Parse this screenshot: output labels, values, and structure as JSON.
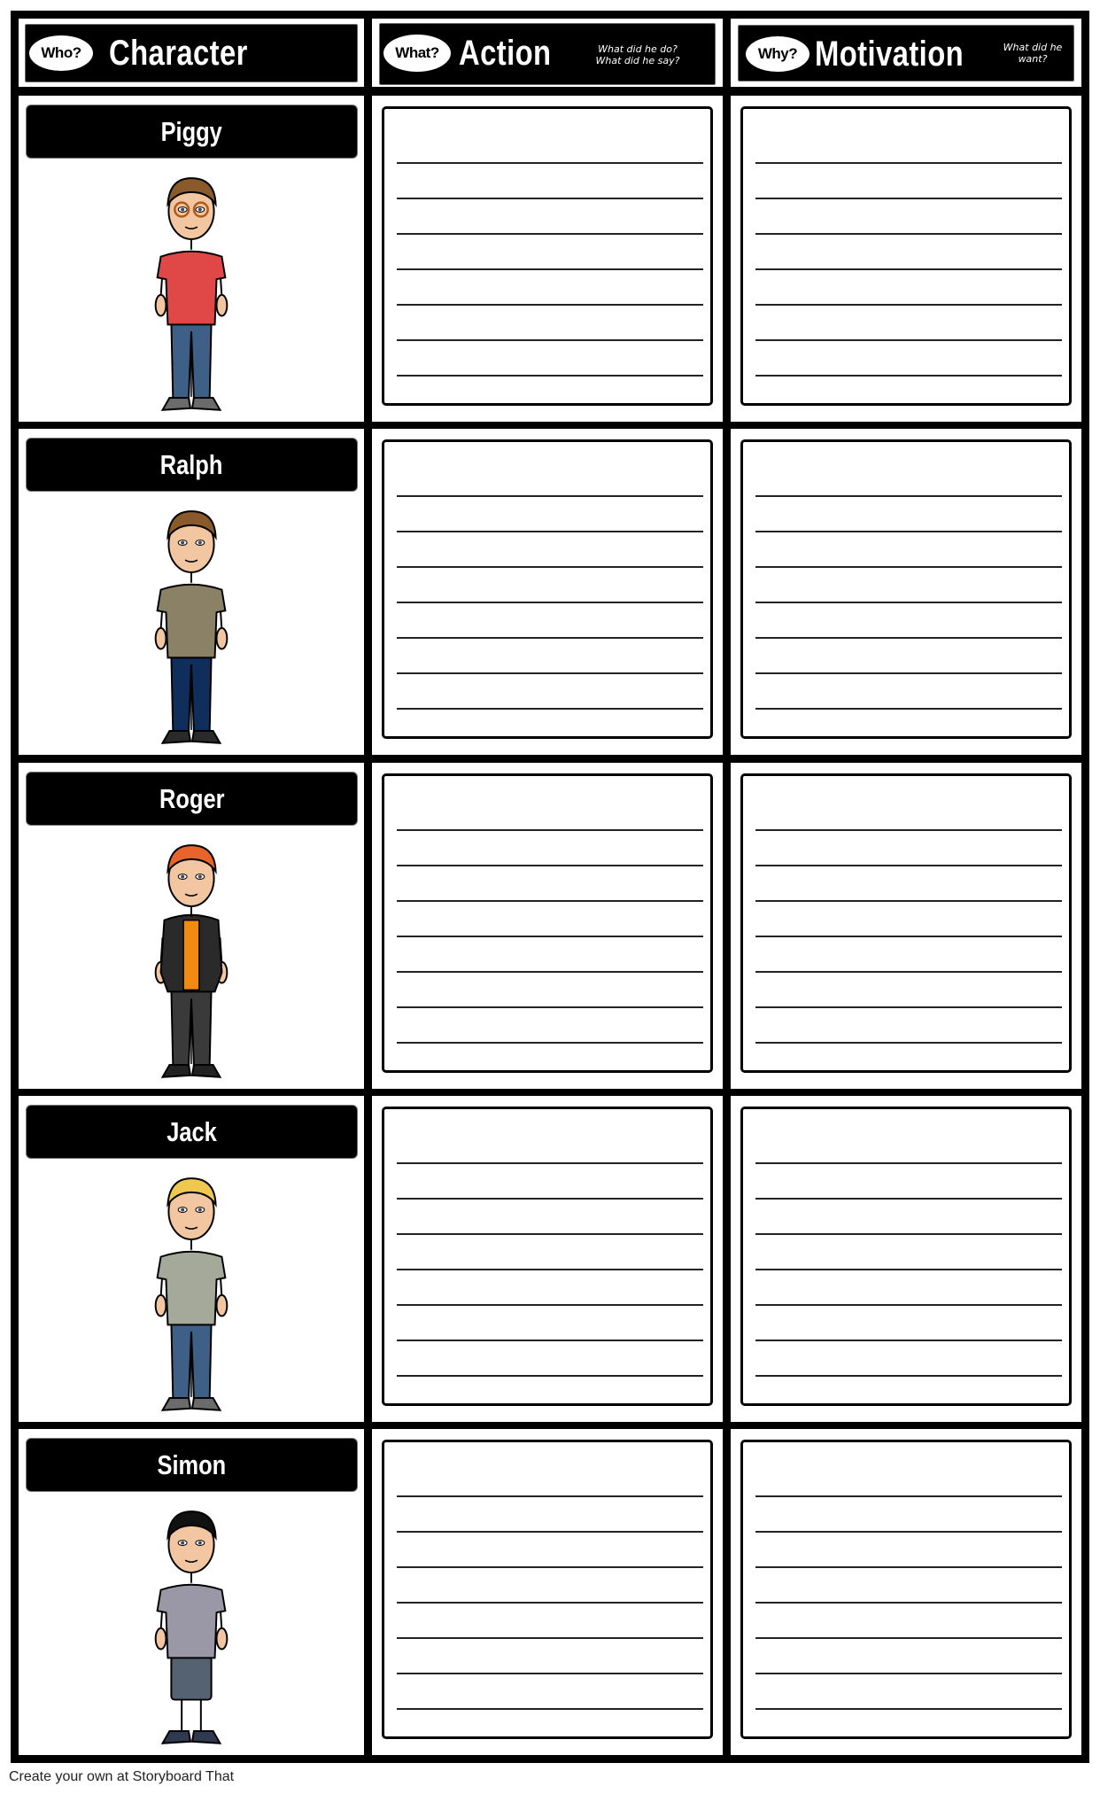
{
  "header": {
    "columns": [
      {
        "badge": "Who?",
        "title": "Character",
        "subtitle": ""
      },
      {
        "badge": "What?",
        "title": "Action",
        "subtitle_lines": [
          "What did he do?",
          "What did he say?"
        ]
      },
      {
        "badge": "Why?",
        "title": "Motivation",
        "subtitle_lines": [
          "What did he",
          "want?"
        ]
      }
    ]
  },
  "rows": [
    {
      "name": "Piggy",
      "colors": {
        "hair": "#8a5a2b",
        "shirt": "#e04848",
        "pants": "#3e5f86",
        "shoes": "#6b6b6b",
        "skin": "#f2c6a0"
      }
    },
    {
      "name": "Ralph",
      "colors": {
        "hair": "#8a5a2b",
        "shirt": "#8a8166",
        "pants": "#0f2e5c",
        "shoes": "#2a2a2a",
        "skin": "#f2c6a0"
      }
    },
    {
      "name": "Roger",
      "colors": {
        "hair": "#e8642a",
        "shirt": "#2a2a2a",
        "undershirt": "#f08a12",
        "pants": "#3a3a3a",
        "shoes": "#222222",
        "skin": "#f2c6a0"
      }
    },
    {
      "name": "Jack",
      "colors": {
        "hair": "#f0c850",
        "shirt": "#a4a99a",
        "pants": "#3e5f86",
        "shoes": "#6b6b6b",
        "skin": "#f2c6a0"
      }
    },
    {
      "name": "Simon",
      "colors": {
        "hair": "#111111",
        "shirt": "#9a97a6",
        "pants": "#556270",
        "shoes": "#2f3a50",
        "skin": "#f2c6a0"
      }
    }
  ],
  "writing_box": {
    "line_count": 7
  },
  "footer": {
    "credit": "Create your own at Storyboard That"
  }
}
